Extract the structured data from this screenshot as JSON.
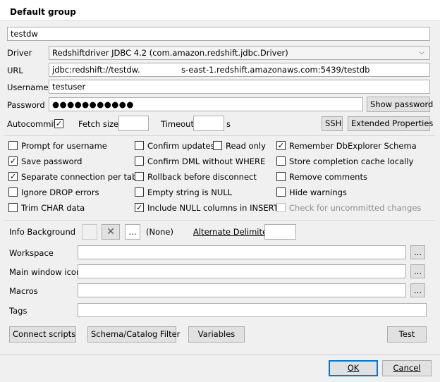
{
  "group_title": "Default group",
  "profile_name": "testdw",
  "driver": {
    "label": "Driver",
    "value": "Redshiftdriver JDBC 4.2 (com.amazon.redshift.jdbc.Driver)"
  },
  "url": {
    "label": "URL",
    "value": "jdbc:redshift://testdw.                s-east-1.redshift.amazonaws.com:5439/testdb"
  },
  "username": {
    "label": "Username",
    "value": "testuser"
  },
  "password": {
    "label": "Password",
    "value": "●●●●●●●●●●●",
    "show_label": "Show password"
  },
  "options_row": {
    "autocommit_label": "Autocommit",
    "autocommit_checked": true,
    "fetch_size_label": "Fetch size",
    "fetch_size_value": "",
    "timeout_label": "Timeout",
    "timeout_value": "",
    "timeout_unit": "s",
    "ssh_label": "SSH",
    "extended_label": "Extended Properties"
  },
  "checkboxes": {
    "prompt_username": {
      "label": "Prompt for username",
      "checked": false
    },
    "save_password": {
      "label": "Save password",
      "checked": true
    },
    "separate_connection": {
      "label": "Separate connection per tab",
      "checked": true
    },
    "ignore_drop": {
      "label": "Ignore DROP errors",
      "checked": false
    },
    "trim_char": {
      "label": "Trim CHAR data",
      "checked": false
    },
    "confirm_updates": {
      "label": "Confirm updates",
      "checked": false
    },
    "read_only": {
      "label": "Read only",
      "checked": false
    },
    "confirm_dml": {
      "label": "Confirm DML without WHERE",
      "checked": false
    },
    "rollback": {
      "label": "Rollback before disconnect",
      "checked": false
    },
    "empty_null": {
      "label": "Empty string is NULL",
      "checked": false
    },
    "include_null": {
      "label": "Include NULL columns in INSERTs",
      "checked": true
    },
    "remember_schema": {
      "label": "Remember DbExplorer Schema",
      "checked": true
    },
    "store_cache": {
      "label": "Store completion cache locally",
      "checked": false
    },
    "remove_comments": {
      "label": "Remove comments",
      "checked": false
    },
    "hide_warnings": {
      "label": "Hide warnings",
      "checked": false
    },
    "check_uncommitted": {
      "label": "Check for uncommitted changes",
      "checked": false,
      "disabled": true
    }
  },
  "info_bg": {
    "label": "Info Background",
    "clear_glyph": "✕",
    "browse_glyph": "...",
    "none_label": "(None)",
    "alt_delim_label": "Alternate Delimiter",
    "alt_delim_value": ""
  },
  "workspace": {
    "label": "Workspace",
    "value": "",
    "browse": "..."
  },
  "main_icon": {
    "label": "Main window icon",
    "value": "",
    "browse": "..."
  },
  "macros": {
    "label": "Macros",
    "value": "",
    "browse": "..."
  },
  "tags": {
    "label": "Tags",
    "value": ""
  },
  "buttons": {
    "connect_scripts": "Connect scripts",
    "schema_filter": "Schema/Catalog Filter",
    "variables": "Variables",
    "test": "Test",
    "ok": "OK",
    "cancel": "Cancel"
  },
  "icons": {
    "combo": "chevron-down-icon",
    "clear": "close-icon",
    "check": "check-icon"
  }
}
